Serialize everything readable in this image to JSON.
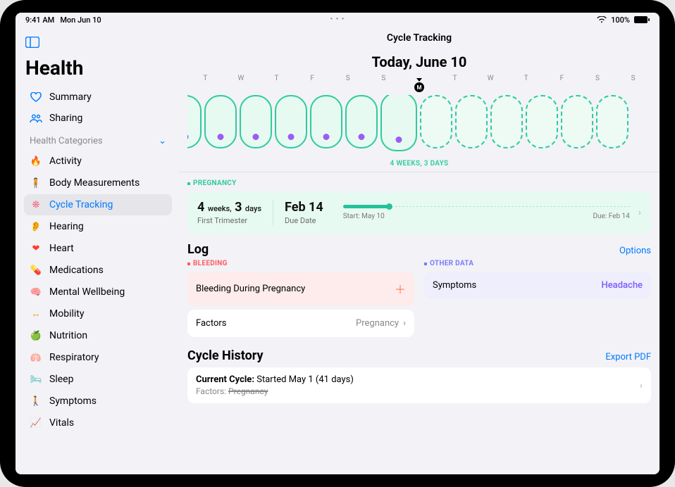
{
  "status": {
    "time": "9:41 AM",
    "date": "Mon Jun 10",
    "battery": "100%"
  },
  "sidebar": {
    "app_title": "Health",
    "nav": [
      {
        "label": "Summary",
        "icon": "heart-outline"
      },
      {
        "label": "Sharing",
        "icon": "people"
      }
    ],
    "categories_header": "Health Categories",
    "categories": [
      {
        "label": "Activity",
        "icon": "flame",
        "color": "#ff3b30"
      },
      {
        "label": "Body Measurements",
        "icon": "body",
        "color": "#af52de"
      },
      {
        "label": "Cycle Tracking",
        "icon": "cycle",
        "color": "#ff2d55",
        "selected": true
      },
      {
        "label": "Hearing",
        "icon": "ear",
        "color": "#007aff"
      },
      {
        "label": "Heart",
        "icon": "heart-fill",
        "color": "#ff3b30"
      },
      {
        "label": "Medications",
        "icon": "pill",
        "color": "#2fc6c4"
      },
      {
        "label": "Mental Wellbeing",
        "icon": "brain",
        "color": "#64d2a2"
      },
      {
        "label": "Mobility",
        "icon": "mobility",
        "color": "#ff9500"
      },
      {
        "label": "Nutrition",
        "icon": "apple",
        "color": "#34c759"
      },
      {
        "label": "Respiratory",
        "icon": "lungs",
        "color": "#2aa8d8"
      },
      {
        "label": "Sleep",
        "icon": "bed",
        "color": "#2fb5b0"
      },
      {
        "label": "Symptoms",
        "icon": "walk",
        "color": "#5e7bff"
      },
      {
        "label": "Vitals",
        "icon": "vitals",
        "color": "#ff3b30"
      }
    ]
  },
  "content": {
    "page_title": "Cycle Tracking",
    "today_label": "Today, June 10",
    "cal_letters": [
      "T",
      "W",
      "T",
      "F",
      "S",
      "S",
      "M",
      "T",
      "W",
      "T",
      "F",
      "S",
      "S"
    ],
    "today_index": 6,
    "duration": "4 WEEKS, 3 DAYS",
    "pregnancy_tag": "PREGNANCY",
    "pregnancy": {
      "weeks": "4",
      "weeks_unit": "weeks,",
      "days": "3",
      "days_unit": "days",
      "stage": "First Trimester",
      "due_val": "Feb 14",
      "due_label": "Due Date",
      "start_label": "Start: May 10",
      "end_label": "Due: Feb 14"
    },
    "log_header": "Log",
    "options_label": "Options",
    "bleeding_tag": "BLEEDING",
    "other_tag": "OTHER DATA",
    "bleeding_card": "Bleeding During Pregnancy",
    "factors_card": {
      "label": "Factors",
      "value": "Pregnancy"
    },
    "symptoms_card": {
      "label": "Symptoms",
      "value": "Headache"
    },
    "history_header": "Cycle History",
    "export_label": "Export PDF",
    "history": {
      "line1_bold": "Current Cycle:",
      "line1_rest": " Started May 1 (41 days)",
      "line2_label": "Factors: ",
      "line2_value": "Pregnancy"
    }
  }
}
